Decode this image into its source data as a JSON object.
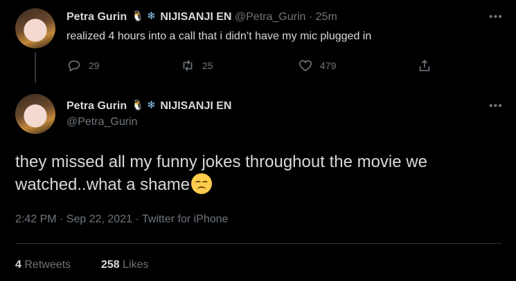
{
  "reply_tweet": {
    "display_name": "Petra Gurin",
    "badges": [
      "🐧",
      "❄"
    ],
    "org": "NIJISANJI EN",
    "handle": "@Petra_Gurin",
    "separator": "·",
    "time": "25m",
    "text": "realized 4 hours into a call that i didn’t have my mic plugged in",
    "more": "•••",
    "actions": {
      "reply_count": "29",
      "retweet_count": "25",
      "like_count": "479"
    }
  },
  "main_tweet": {
    "display_name": "Petra Gurin",
    "badges": [
      "🐧",
      "❄"
    ],
    "org": "NIJISANJI EN",
    "handle": "@Petra_Gurin",
    "more": "•••",
    "text": "they missed all my funny jokes throughout the movie we watched..what a shame",
    "emoji": "disappointed-face",
    "timestamp": "2:42 PM · Sep 22, 2021 · Twitter for iPhone",
    "retweets_count": "4",
    "retweets_label": "Retweets",
    "likes_count": "258",
    "likes_label": "Likes"
  },
  "colors": {
    "background": "#000000",
    "text": "#d9d9d9",
    "muted": "#6e767d",
    "divider": "#2f3336"
  }
}
